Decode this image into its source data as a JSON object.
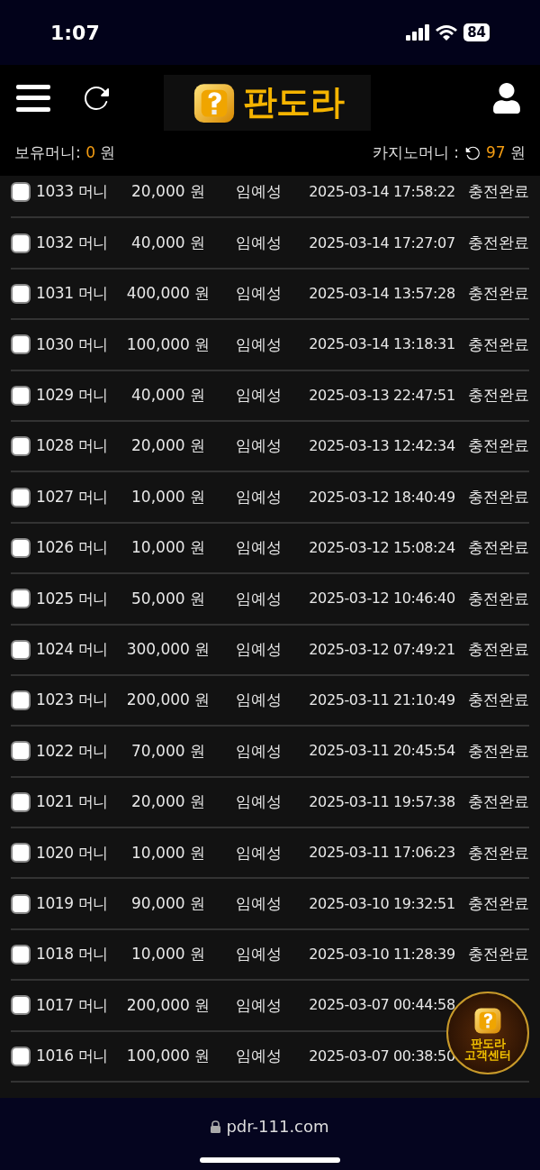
{
  "status_bar": {
    "time": "1:07",
    "battery": "84"
  },
  "header": {
    "logo_text": "판도라"
  },
  "balance": {
    "label": "보유머니:",
    "amount": "0",
    "unit": "원"
  },
  "casino_balance": {
    "label": "카지노머니 :",
    "amount": "97",
    "unit": "원"
  },
  "rows": [
    {
      "checked": false,
      "id": "1033 머니",
      "amount": "20,000 원",
      "name": "임예성",
      "date": "2025-03-14 17:58:22",
      "status": "충전완료"
    },
    {
      "checked": false,
      "id": "1032 머니",
      "amount": "40,000 원",
      "name": "임예성",
      "date": "2025-03-14 17:27:07",
      "status": "충전완료"
    },
    {
      "checked": false,
      "id": "1031 머니",
      "amount": "400,000 원",
      "name": "임예성",
      "date": "2025-03-14 13:57:28",
      "status": "충전완료"
    },
    {
      "checked": false,
      "id": "1030 머니",
      "amount": "100,000 원",
      "name": "임예성",
      "date": "2025-03-14 13:18:31",
      "status": "충전완료"
    },
    {
      "checked": false,
      "id": "1029 머니",
      "amount": "40,000 원",
      "name": "임예성",
      "date": "2025-03-13 22:47:51",
      "status": "충전완료"
    },
    {
      "checked": false,
      "id": "1028 머니",
      "amount": "20,000 원",
      "name": "임예성",
      "date": "2025-03-13 12:42:34",
      "status": "충전완료"
    },
    {
      "checked": false,
      "id": "1027 머니",
      "amount": "10,000 원",
      "name": "임예성",
      "date": "2025-03-12 18:40:49",
      "status": "충전완료"
    },
    {
      "checked": false,
      "id": "1026 머니",
      "amount": "10,000 원",
      "name": "임예성",
      "date": "2025-03-12 15:08:24",
      "status": "충전완료"
    },
    {
      "checked": false,
      "id": "1025 머니",
      "amount": "50,000 원",
      "name": "임예성",
      "date": "2025-03-12 10:46:40",
      "status": "충전완료"
    },
    {
      "checked": false,
      "id": "1024 머니",
      "amount": "300,000 원",
      "name": "임예성",
      "date": "2025-03-12 07:49:21",
      "status": "충전완료"
    },
    {
      "checked": false,
      "id": "1023 머니",
      "amount": "200,000 원",
      "name": "임예성",
      "date": "2025-03-11 21:10:49",
      "status": "충전완료"
    },
    {
      "checked": false,
      "id": "1022 머니",
      "amount": "70,000 원",
      "name": "임예성",
      "date": "2025-03-11 20:45:54",
      "status": "충전완료"
    },
    {
      "checked": false,
      "id": "1021 머니",
      "amount": "20,000 원",
      "name": "임예성",
      "date": "2025-03-11 19:57:38",
      "status": "충전완료"
    },
    {
      "checked": false,
      "id": "1020 머니",
      "amount": "10,000 원",
      "name": "임예성",
      "date": "2025-03-11 17:06:23",
      "status": "충전완료"
    },
    {
      "checked": false,
      "id": "1019 머니",
      "amount": "90,000 원",
      "name": "임예성",
      "date": "2025-03-10 19:32:51",
      "status": "충전완료"
    },
    {
      "checked": false,
      "id": "1018 머니",
      "amount": "10,000 원",
      "name": "임예성",
      "date": "2025-03-10 11:28:39",
      "status": "충전완료"
    },
    {
      "checked": false,
      "id": "1017 머니",
      "amount": "200,000 원",
      "name": "임예성",
      "date": "2025-03-07 00:44:58"
    },
    {
      "checked": false,
      "id": "1016 머니",
      "amount": "100,000 원",
      "name": "임예성",
      "date": "2025-03-07 00:38:50"
    }
  ],
  "support_badge": {
    "line1": "판도라",
    "line2": "고객센터"
  },
  "address_bar": {
    "url": "pdr-111.com"
  }
}
